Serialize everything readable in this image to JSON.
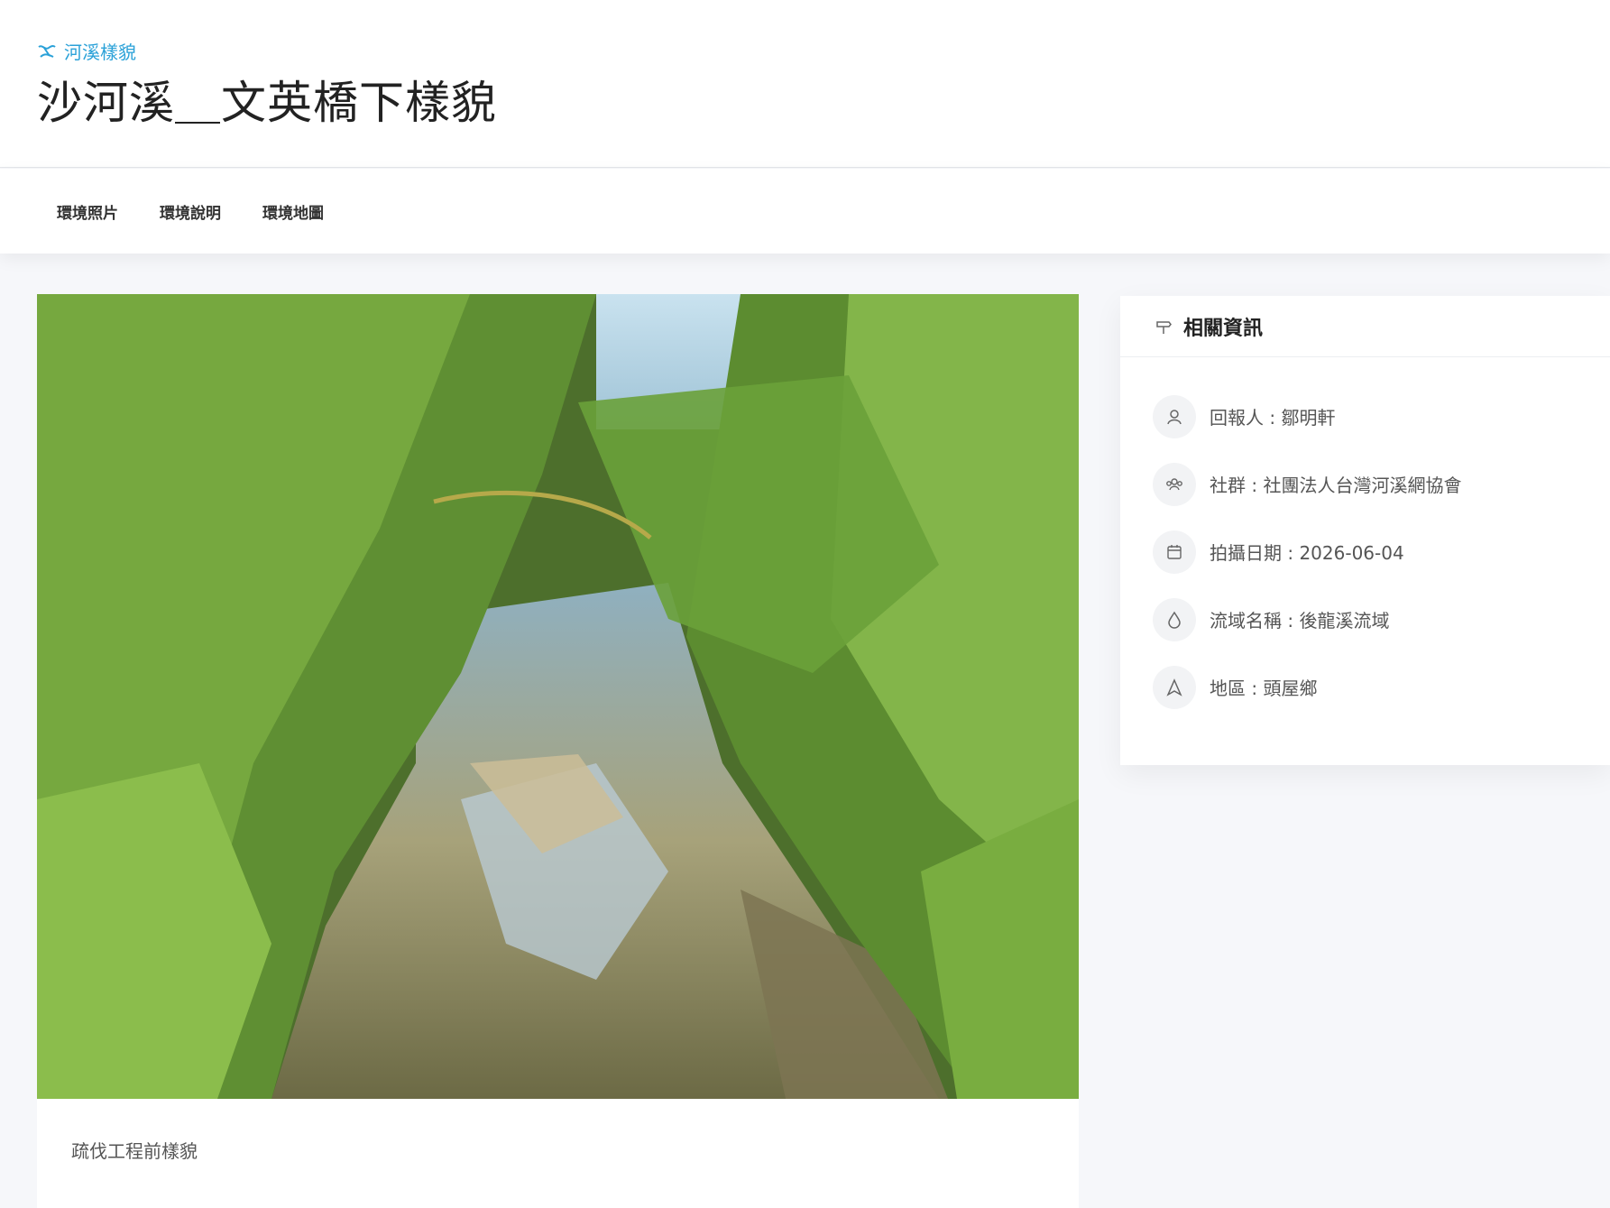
{
  "header": {
    "breadcrumb": "河溪樣貌",
    "title": "沙河溪＿文英橋下樣貌"
  },
  "tabs": [
    {
      "label": "環境照片"
    },
    {
      "label": "環境說明"
    },
    {
      "label": "環境地圖"
    }
  ],
  "photo": {
    "caption": "疏伐工程前樣貌"
  },
  "info": {
    "heading": "相關資訊",
    "items": [
      {
        "icon": "user-icon",
        "text": "回報人 : 鄒明軒"
      },
      {
        "icon": "group-icon",
        "text": "社群 : 社團法人台灣河溪網協會"
      },
      {
        "icon": "calendar-icon",
        "text": "拍攝日期 : 2026-06-04"
      },
      {
        "icon": "water-drop-icon",
        "text": "流域名稱 : 後龍溪流域"
      },
      {
        "icon": "location-icon",
        "text": "地區 : 頭屋鄉"
      }
    ]
  },
  "colors": {
    "accent": "#2aa1d8",
    "background": "#f6f7fa"
  }
}
